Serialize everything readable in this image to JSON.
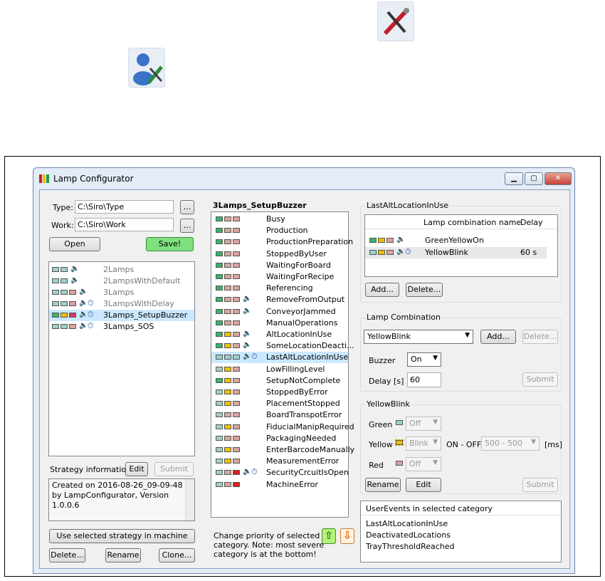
{
  "window": {
    "title": "Lamp Configurator",
    "min": "▁",
    "max": "▢",
    "close": "✕"
  },
  "left": {
    "type_label": "Type:",
    "type_value": "C:\\Siro\\Type",
    "work_label": "Work:",
    "work_value": "C:\\Siro\\Work",
    "browse": "...",
    "open": "Open",
    "save": "Save!",
    "strategies": [
      {
        "name": "2Lamps",
        "lamps": [
          "#9ed0c9",
          "#9ed0c9"
        ],
        "buzzer": true,
        "timer": false,
        "active": false
      },
      {
        "name": "2LampsWithDefault",
        "lamps": [
          "#9ed0c9",
          "#9ed0c9"
        ],
        "buzzer": true,
        "timer": false,
        "active": false
      },
      {
        "name": "3Lamps",
        "lamps": [
          "#9ed0c9",
          "#9ed0c9",
          "#d9a49e"
        ],
        "buzzer": true,
        "timer": false,
        "active": false
      },
      {
        "name": "3LampsWithDelay",
        "lamps": [
          "#9ed0c9",
          "#9ed0c9",
          "#d9a49e"
        ],
        "buzzer": true,
        "timer": true,
        "active": false
      },
      {
        "name": "3Lamps_SetupBuzzer",
        "lamps": [
          "#3ab36a",
          "#f0c000",
          "#d9365e"
        ],
        "buzzer": true,
        "timer": true,
        "active": true
      },
      {
        "name": "3Lamps_SOS",
        "lamps": [
          "#9ed0c9",
          "#9ed0c9",
          "#d9a49e"
        ],
        "buzzer": true,
        "timer": true,
        "active": true
      }
    ],
    "strategy_info_label": "Strategy information",
    "edit": "Edit",
    "submit": "Submit",
    "info_text": "Created on 2016-08-26_09-09-48 by LampConfigurator, Version 1.0.0.6",
    "use_strategy": "Use selected strategy in machine",
    "delete": "Delete...",
    "rename": "Rename",
    "clone": "Clone..."
  },
  "middle": {
    "heading": "3Lamps_SetupBuzzer",
    "events": [
      {
        "name": "Busy",
        "lamps": [
          "g",
          "p",
          "p"
        ],
        "buzzer": false,
        "timer": false
      },
      {
        "name": "Production",
        "lamps": [
          "g",
          "p",
          "p"
        ],
        "buzzer": false,
        "timer": false
      },
      {
        "name": "ProductionPreparation",
        "lamps": [
          "g",
          "p",
          "p"
        ],
        "buzzer": false,
        "timer": false
      },
      {
        "name": "StoppedByUser",
        "lamps": [
          "g",
          "p",
          "p"
        ],
        "buzzer": false,
        "timer": false
      },
      {
        "name": "WaitingForBoard",
        "lamps": [
          "g",
          "p",
          "p"
        ],
        "buzzer": false,
        "timer": false
      },
      {
        "name": "WaitingForRecipe",
        "lamps": [
          "g",
          "p",
          "p"
        ],
        "buzzer": false,
        "timer": false
      },
      {
        "name": "Referencing",
        "lamps": [
          "g",
          "p",
          "p"
        ],
        "buzzer": false,
        "timer": false
      },
      {
        "name": "RemoveFromOutput",
        "lamps": [
          "g",
          "p",
          "p"
        ],
        "buzzer": true,
        "timer": false
      },
      {
        "name": "ConveyorJammed",
        "lamps": [
          "g",
          "p",
          "p"
        ],
        "buzzer": true,
        "timer": false
      },
      {
        "name": "ManualOperations",
        "lamps": [
          "g",
          "p",
          "p"
        ],
        "buzzer": false,
        "timer": false
      },
      {
        "name": "AltLocationInUse",
        "lamps": [
          "g",
          "y",
          "p"
        ],
        "buzzer": true,
        "timer": false
      },
      {
        "name": "SomeLocationDeacti...",
        "lamps": [
          "g",
          "y",
          "p"
        ],
        "buzzer": true,
        "timer": false
      },
      {
        "name": "LastAltLocationInUse",
        "lamps": [
          "t",
          "t",
          "t"
        ],
        "buzzer": true,
        "timer": true
      },
      {
        "name": "LowFillingLevel",
        "lamps": [
          "t",
          "y",
          "p"
        ],
        "buzzer": false,
        "timer": false
      },
      {
        "name": "SetupNotComplete",
        "lamps": [
          "g",
          "y",
          "p"
        ],
        "buzzer": false,
        "timer": false
      },
      {
        "name": "StoppedByError",
        "lamps": [
          "t",
          "y",
          "p"
        ],
        "buzzer": false,
        "timer": false
      },
      {
        "name": "PlacementStopped",
        "lamps": [
          "t",
          "y",
          "p"
        ],
        "buzzer": false,
        "timer": false
      },
      {
        "name": "BoardTranspotError",
        "lamps": [
          "t",
          "p",
          "p"
        ],
        "buzzer": false,
        "timer": false
      },
      {
        "name": "FiducialManipRequired",
        "lamps": [
          "t",
          "y",
          "p"
        ],
        "buzzer": false,
        "timer": false
      },
      {
        "name": "PackagingNeeded",
        "lamps": [
          "t",
          "p",
          "p"
        ],
        "buzzer": false,
        "timer": false
      },
      {
        "name": "EnterBarcodeManually",
        "lamps": [
          "t",
          "y",
          "p"
        ],
        "buzzer": false,
        "timer": false
      },
      {
        "name": "MeasurementError",
        "lamps": [
          "t",
          "y",
          "p"
        ],
        "buzzer": false,
        "timer": false
      },
      {
        "name": "SecurityCrcuitIsOpen",
        "lamps": [
          "t",
          "p",
          "r"
        ],
        "buzzer": true,
        "timer": true
      },
      {
        "name": "MachineError",
        "lamps": [
          "t",
          "p",
          "r"
        ],
        "buzzer": false,
        "timer": false
      }
    ],
    "priority_text_1": "Change priority of selected",
    "priority_text_2": "category. Note: most severe",
    "priority_text_3": "category is at the bottom!",
    "up_arrow": "⇧",
    "down_arrow": "⇩"
  },
  "right": {
    "lac_group": "LastAltLocationInUse",
    "col_name": "Lamp combination name",
    "col_delay": "Delay",
    "combos": [
      {
        "name": "GreenYellowOn",
        "delay": "",
        "lamps": [
          "g",
          "y",
          "p"
        ],
        "buzzer": true,
        "timer": false
      },
      {
        "name": "YellowBlink",
        "delay": "60 s",
        "lamps": [
          "t",
          "y",
          "p"
        ],
        "buzzer": true,
        "timer": true
      }
    ],
    "add": "Add...",
    "delete": "Delete...",
    "lc_group": "Lamp Combination",
    "lc_selected": "YellowBlink",
    "buzzer_label": "Buzzer",
    "buzzer_value": "On",
    "delay_label": "Delay [s]",
    "delay_value": "60",
    "submit": "Submit",
    "yb_group": "YellowBlink",
    "green_label": "Green",
    "green_value": "Off",
    "yellow_label": "Yellow",
    "yellow_value": "Blink",
    "onoff_label": "ON - OFF",
    "onoff_value": "500 - 500",
    "ms_label": "[ms]",
    "red_label": "Red",
    "red_value": "Off",
    "rename": "Rename",
    "edit": "Edit",
    "ue_header": "UserEvents in selected category",
    "user_events": [
      "LastAltLocationInUse",
      "DeactivatedLocations",
      "TrayThresholdReached"
    ]
  },
  "colors": {
    "g": "#3ab36a",
    "p": "#d9a49e",
    "y": "#f0c000",
    "r": "#e02020",
    "t": "#9ed0c9",
    "accent": "#3399ff"
  }
}
